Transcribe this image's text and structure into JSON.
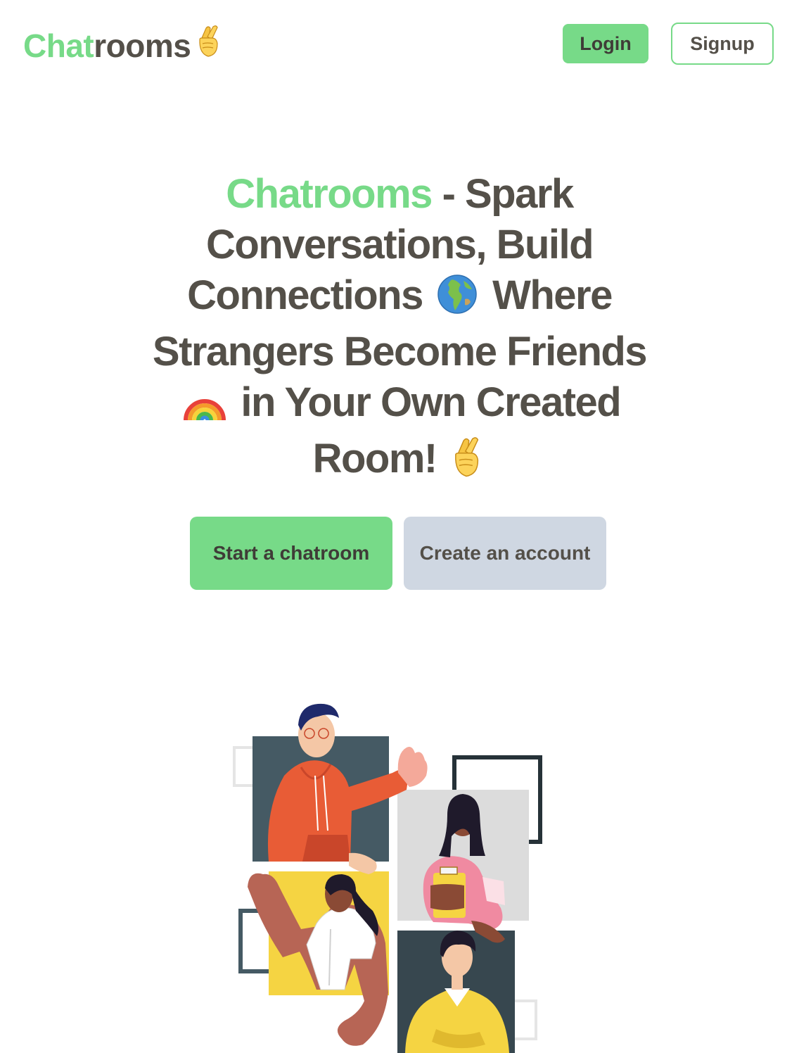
{
  "header": {
    "brand_accent": "Chat",
    "brand_rest": "rooms",
    "brand_emoji": "crossed-fingers",
    "login_label": "Login",
    "signup_label": "Signup"
  },
  "hero": {
    "title_accent": "Chatrooms",
    "title_part1": " - Spark Conversations, Build Connections",
    "title_part2": "Where Strangers Become Friends",
    "title_part3": "in Your Own Created Room!",
    "start_label": "Start a chatroom",
    "create_label": "Create an account"
  },
  "illustration": {
    "name": "people-video-chat-illustration"
  },
  "colors": {
    "accent": "#77da88",
    "text": "#545049",
    "secondary_button": "#cfd7e2"
  }
}
